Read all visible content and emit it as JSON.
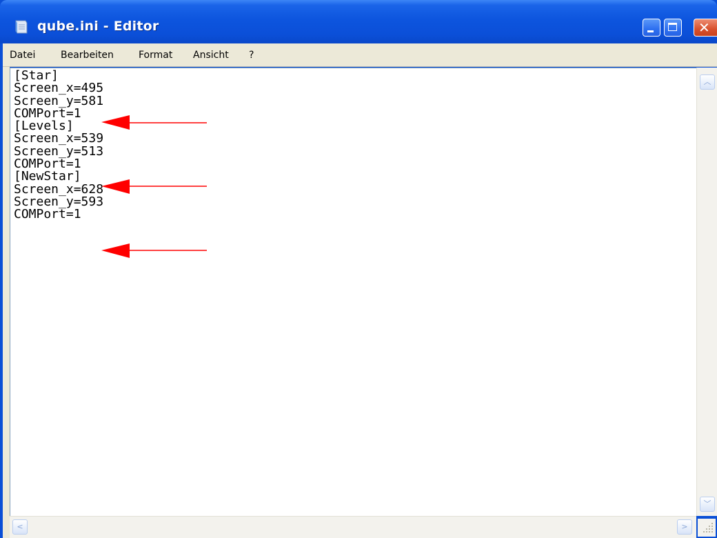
{
  "window": {
    "title": "qube.ini - Editor",
    "icon": "notepad-icon"
  },
  "window_controls": {
    "minimize_icon": "minimize-icon",
    "maximize_icon": "maximize-icon",
    "close_icon": "close-icon"
  },
  "menu": {
    "items": [
      "Datei",
      "Bearbeiten",
      "Format",
      "Ansicht",
      "?"
    ]
  },
  "editor": {
    "lines": [
      "[Star]",
      "Screen_x=495",
      "Screen_y=581",
      "COMPort=1",
      "[Levels]",
      "Screen_x=539",
      "Screen_y=513",
      "COMPort=1",
      "[NewStar]",
      "Screen_x=628",
      "Screen_y=593",
      "COMPort=1"
    ]
  },
  "annotations": {
    "arrow_color": "#ff0000",
    "arrow_icon": "red-arrow-left"
  },
  "colors": {
    "titlebar": "#0b4fd8",
    "menubar": "#ece9d8",
    "close_button": "#d8502d"
  }
}
